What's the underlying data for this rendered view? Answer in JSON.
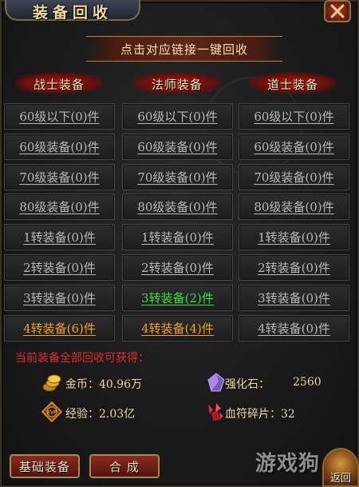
{
  "window": {
    "title": "装备回收"
  },
  "banner": {
    "text": "点击对应链接一键回收"
  },
  "columns": [
    {
      "header": "战士装备",
      "items": [
        {
          "label": "60级以下(0)件",
          "color": "#b9b9b9"
        },
        {
          "label": "60级装备(0)件",
          "color": "#b9b9b9"
        },
        {
          "label": "70级装备(0)件",
          "color": "#b9b9b9"
        },
        {
          "label": "80级装备(0)件",
          "color": "#b9b9b9"
        },
        {
          "label": "1转装备(0)件",
          "color": "#b9b9b9"
        },
        {
          "label": "2转装备(0)件",
          "color": "#b9b9b9"
        },
        {
          "label": "3转装备(0)件",
          "color": "#b9b9b9"
        },
        {
          "label": "4转装备(6)件",
          "color": "#f0a22c"
        }
      ]
    },
    {
      "header": "法师装备",
      "items": [
        {
          "label": "60级以下(0)件",
          "color": "#b9b9b9"
        },
        {
          "label": "60级装备(0)件",
          "color": "#b9b9b9"
        },
        {
          "label": "70级装备(0)件",
          "color": "#b9b9b9"
        },
        {
          "label": "80级装备(0)件",
          "color": "#b9b9b9"
        },
        {
          "label": "1转装备(0)件",
          "color": "#b9b9b9"
        },
        {
          "label": "2转装备(0)件",
          "color": "#b9b9b9"
        },
        {
          "label": "3转装备(2)件",
          "color": "#3ee04a"
        },
        {
          "label": "4转装备(4)件",
          "color": "#f0a22c"
        }
      ]
    },
    {
      "header": "道士装备",
      "items": [
        {
          "label": "60级以下(0)件",
          "color": "#b9b9b9"
        },
        {
          "label": "60级装备(0)件",
          "color": "#b9b9b9"
        },
        {
          "label": "70级装备(0)件",
          "color": "#b9b9b9"
        },
        {
          "label": "80级装备(0)件",
          "color": "#b9b9b9"
        },
        {
          "label": "1转装备(0)件",
          "color": "#b9b9b9"
        },
        {
          "label": "2转装备(0)件",
          "color": "#b9b9b9"
        },
        {
          "label": "3转装备(0)件",
          "color": "#b9b9b9"
        },
        {
          "label": "4转装备(0)件",
          "color": "#b9b9b9"
        }
      ]
    }
  ],
  "summary": {
    "label": "当前装备全部回收可获得：",
    "gold": "金币：40.96万",
    "exp": "经验：2.03亿",
    "stone_label": "强化石：",
    "stone_value": "2560",
    "blood": "血符碎片：32"
  },
  "buttons": {
    "basic": "基础装备",
    "compose": "合 成",
    "return": "返回"
  },
  "watermark": "游戏狗"
}
